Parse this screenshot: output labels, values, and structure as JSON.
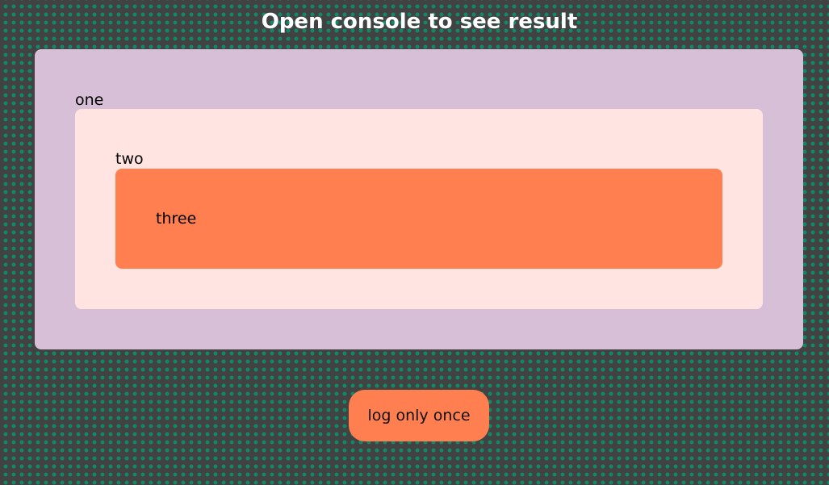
{
  "header": {
    "title": "Open console to see result"
  },
  "boxes": {
    "one": {
      "label": "one",
      "color": "#d8bfd8"
    },
    "two": {
      "label": "two",
      "color": "#ffe4e1"
    },
    "three": {
      "label": "three",
      "color": "#ff7f50"
    }
  },
  "actions": {
    "log_button_label": "log only once",
    "button_color": "#ff7f50"
  },
  "theme": {
    "background": "#424242",
    "dot_color": "#0f8a68"
  }
}
